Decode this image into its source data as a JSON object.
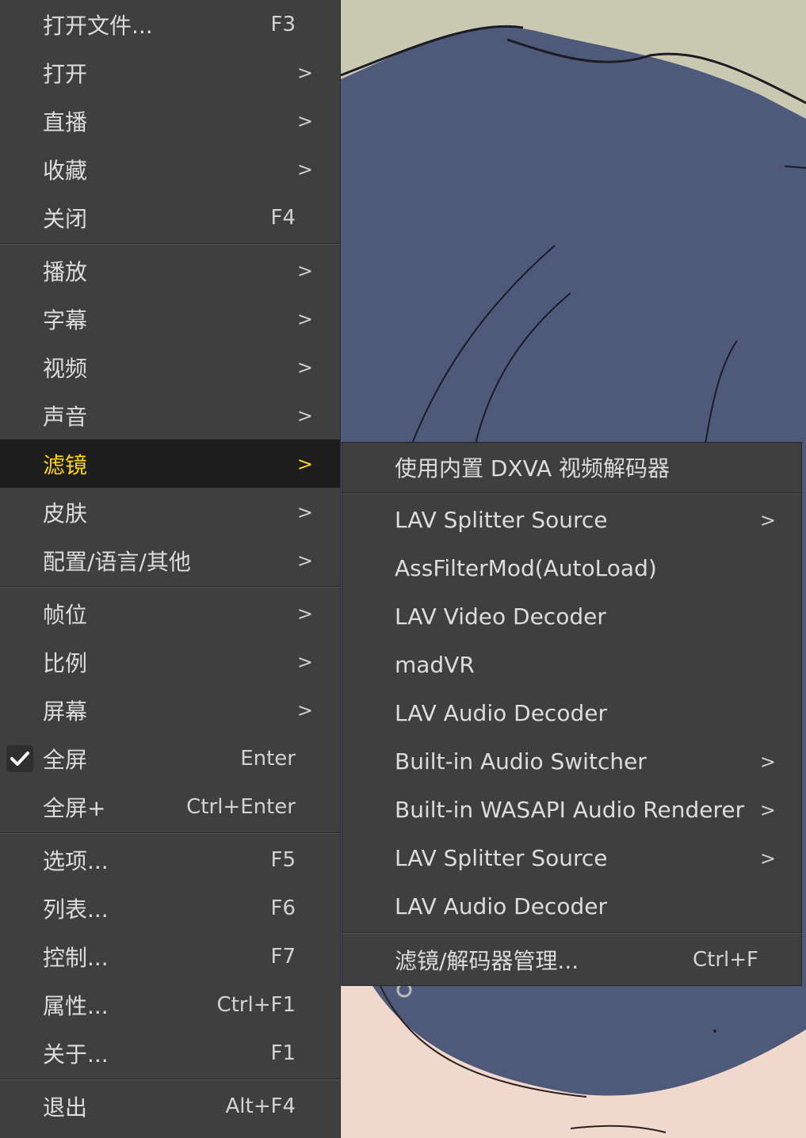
{
  "main_menu": {
    "groups": [
      [
        {
          "label": "打开文件...",
          "shortcut": "F3",
          "submenu": false
        },
        {
          "label": "打开",
          "shortcut": "",
          "submenu": true
        },
        {
          "label": "直播",
          "shortcut": "",
          "submenu": true
        },
        {
          "label": "收藏",
          "shortcut": "",
          "submenu": true
        },
        {
          "label": "关闭",
          "shortcut": "F4",
          "submenu": false
        }
      ],
      [
        {
          "label": "播放",
          "shortcut": "",
          "submenu": true
        },
        {
          "label": "字幕",
          "shortcut": "",
          "submenu": true
        },
        {
          "label": "视频",
          "shortcut": "",
          "submenu": true
        },
        {
          "label": "声音",
          "shortcut": "",
          "submenu": true
        },
        {
          "label": "滤镜",
          "shortcut": "",
          "submenu": true,
          "highlighted": true
        },
        {
          "label": "皮肤",
          "shortcut": "",
          "submenu": true
        },
        {
          "label": "配置/语言/其他",
          "shortcut": "",
          "submenu": true
        }
      ],
      [
        {
          "label": "帧位",
          "shortcut": "",
          "submenu": true
        },
        {
          "label": "比例",
          "shortcut": "",
          "submenu": true
        },
        {
          "label": "屏幕",
          "shortcut": "",
          "submenu": true
        },
        {
          "label": "全屏",
          "shortcut": "Enter",
          "submenu": false,
          "checked": true
        },
        {
          "label": "全屏+",
          "shortcut": "Ctrl+Enter",
          "submenu": false
        }
      ],
      [
        {
          "label": "选项...",
          "shortcut": "F5",
          "submenu": false
        },
        {
          "label": "列表...",
          "shortcut": "F6",
          "submenu": false
        },
        {
          "label": "控制...",
          "shortcut": "F7",
          "submenu": false
        },
        {
          "label": "属性...",
          "shortcut": "Ctrl+F1",
          "submenu": false
        },
        {
          "label": "关于...",
          "shortcut": "F1",
          "submenu": false
        }
      ],
      [
        {
          "label": "退出",
          "shortcut": "Alt+F4",
          "submenu": false
        }
      ]
    ],
    "arrow_glyph": ">",
    "highlight_color": "#ffd21a"
  },
  "filter_submenu": {
    "groups": [
      [
        {
          "label": "使用内置 DXVA 视频解码器",
          "shortcut": "",
          "submenu": false
        }
      ],
      [
        {
          "label": "LAV Splitter Source",
          "shortcut": "",
          "submenu": true
        },
        {
          "label": "AssFilterMod(AutoLoad)",
          "shortcut": "",
          "submenu": false
        },
        {
          "label": "LAV Video Decoder",
          "shortcut": "",
          "submenu": false
        },
        {
          "label": "madVR",
          "shortcut": "",
          "submenu": false
        },
        {
          "label": "LAV Audio Decoder",
          "shortcut": "",
          "submenu": false
        },
        {
          "label": "Built-in Audio Switcher",
          "shortcut": "",
          "submenu": true
        },
        {
          "label": "Built-in WASAPI Audio Renderer",
          "shortcut": "",
          "submenu": true
        },
        {
          "label": "LAV Splitter Source",
          "shortcut": "",
          "submenu": true
        },
        {
          "label": "LAV Audio Decoder",
          "shortcut": "",
          "submenu": false
        }
      ],
      [
        {
          "label": "滤镜/解码器管理...",
          "shortcut": "Ctrl+F",
          "submenu": false
        }
      ]
    ]
  },
  "colors": {
    "menu_bg": "#3f3f3f",
    "highlight_bg": "#1d1d1d",
    "text": "#dcdcdc",
    "hair": "#4f5a7a",
    "skin": "#f0d8cc"
  }
}
